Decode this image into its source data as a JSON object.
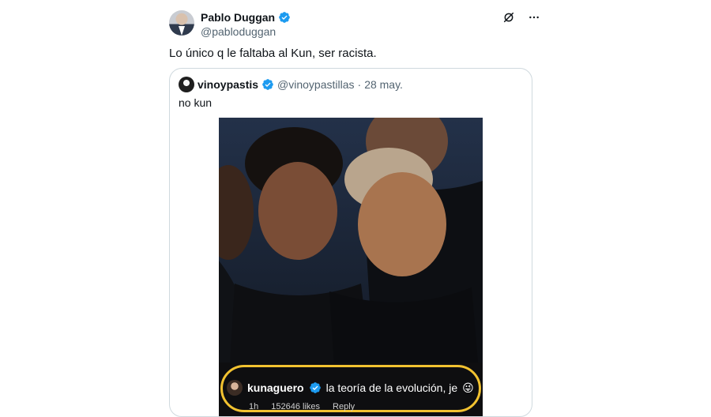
{
  "author": {
    "name": "Pablo Duggan",
    "handle": "@pabloduggan"
  },
  "tweet": {
    "text": "Lo único q le faltaba al Kun, ser racista."
  },
  "actions": {
    "grok_icon": "grok-icon",
    "more_icon": "more-icon"
  },
  "quote": {
    "name": "vinoypastis",
    "handle": "@vinoypastillas",
    "sep": "·",
    "date": "28 may.",
    "text": "no kun"
  },
  "media": {
    "caption_user": "kunaguero",
    "caption_text": "la teoría de la evolución, je",
    "caption_emoji": "😜",
    "time": "1h",
    "likes": "152646 likes",
    "reply": "Reply"
  },
  "colors": {
    "verified": "#1d9bf0",
    "highlight": "#f2c230",
    "border": "#cfd9de"
  }
}
